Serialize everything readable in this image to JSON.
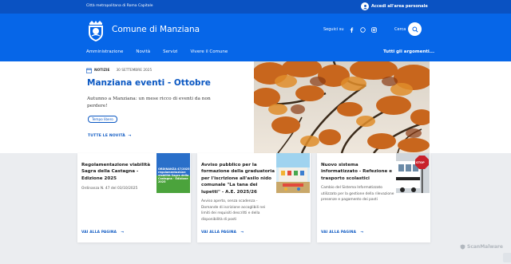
{
  "slim_header": {
    "region_label": "Città metropolitana di Roma Capitale",
    "login_label": "Accedi all'area personale"
  },
  "header": {
    "brand_name": "Comune di Manziana",
    "social_label": "Seguici su",
    "search_label": "Cerca"
  },
  "nav": {
    "items": [
      {
        "label": "Amministrazione"
      },
      {
        "label": "Novità"
      },
      {
        "label": "Servizi"
      },
      {
        "label": "Vivere il Comune"
      }
    ],
    "all_topics": "Tutti gli argomenti..."
  },
  "hero": {
    "category": "NOTIZIE",
    "date": "30 SETTEMBRE 2025",
    "title": "Manziana eventi - Ottobre",
    "description": "Autunno a Manziana: un mese ricco di eventi da non perdere!",
    "tag": "Tempo libero",
    "all_news": "TUTTE LE NOVITÀ"
  },
  "cards": [
    {
      "title": "Regolamentazione viabilità Sagra della Castagna - Edizione 2025",
      "subtitle": "Ordinanza N. 47 del 03/10/2025",
      "link": "VAI ALLA PAGINA",
      "image_text": "ORDINANZA 47/2025 regolamentazione viabilità Sagra della Castagna · Edizione 2025"
    },
    {
      "title": "Avviso pubblico per la formazione della graduatoria per l'iscrizione all'asilo nido comunale \"La tana dei lupetti\" - A.E. 2025/26",
      "subtitle": "Avviso aperto, senza scadenza - Domande di iscrizione accoglibili nei limiti dei requisiti descritti e della disponibilità di posti",
      "link": "VAI ALLA PAGINA"
    },
    {
      "title": "Nuovo sistema informatizzato - Refezione e trasporto scolastici",
      "subtitle": "Cambio del Sistema Informatizzato utilizzato per la gestione della rilevazione presenze e pagamento dei pasti",
      "link": "VAI ALLA PAGINA",
      "image_text": "STOP"
    }
  ],
  "watermark": "ScanMalware",
  "colors": {
    "primary": "#0666e8",
    "slim": "#0a52c2",
    "link": "#0a57c2",
    "grey_band": "#ebedf0"
  }
}
